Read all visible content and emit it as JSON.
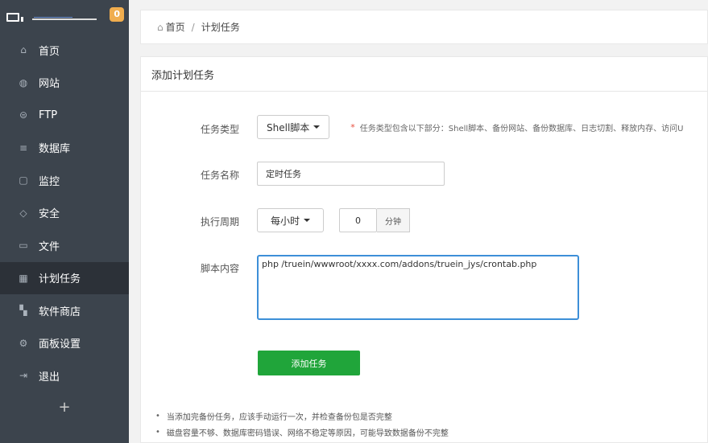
{
  "sidebar": {
    "badge": "0",
    "items": [
      {
        "label": "首页",
        "icon": "home-icon",
        "glyph": "⌂"
      },
      {
        "label": "网站",
        "icon": "globe-icon",
        "glyph": "◍"
      },
      {
        "label": "FTP",
        "icon": "ftp-icon",
        "glyph": "⊜"
      },
      {
        "label": "数据库",
        "icon": "database-icon",
        "glyph": "≡"
      },
      {
        "label": "监控",
        "icon": "monitor-icon",
        "glyph": "▢"
      },
      {
        "label": "安全",
        "icon": "shield-icon",
        "glyph": "◇"
      },
      {
        "label": "文件",
        "icon": "folder-icon",
        "glyph": "▭"
      },
      {
        "label": "计划任务",
        "icon": "calendar-icon",
        "glyph": "▦"
      },
      {
        "label": "软件商店",
        "icon": "apps-icon",
        "glyph": "▚"
      },
      {
        "label": "面板设置",
        "icon": "gear-icon",
        "glyph": "⚙"
      },
      {
        "label": "退出",
        "icon": "logout-icon",
        "glyph": "⇥"
      }
    ],
    "active_index": 7,
    "add_label": "+"
  },
  "breadcrumb": {
    "home": "首页",
    "separator": "/",
    "current": "计划任务"
  },
  "panel": {
    "title": "添加计划任务",
    "task_type": {
      "label": "任务类型",
      "value": "Shell脚本",
      "hint_star": "*",
      "hint": "任务类型包含以下部分：Shell脚本、备份网站、备份数据库、日志切割、释放内存、访问U"
    },
    "task_name": {
      "label": "任务名称",
      "value": "定时任务"
    },
    "period": {
      "label": "执行周期",
      "value": "每小时",
      "minute_value": "0",
      "minute_unit": "分钟"
    },
    "script": {
      "label": "脚本内容",
      "value": "php /truein/wwwroot/xxxx.com/addons/truein_jys/crontab.php"
    },
    "submit_label": "添加任务",
    "notes": [
      "当添加完备份任务，应该手动运行一次，并检查备份包是否完整",
      "磁盘容量不够、数据库密码错误、网络不稳定等原因，可能导致数据备份不完整"
    ]
  },
  "colors": {
    "sidebar": "#3c444d",
    "active": "#2c3138",
    "primary": "#20a53a",
    "focus": "#3d8fd8",
    "badge": "#f0ad4e"
  }
}
